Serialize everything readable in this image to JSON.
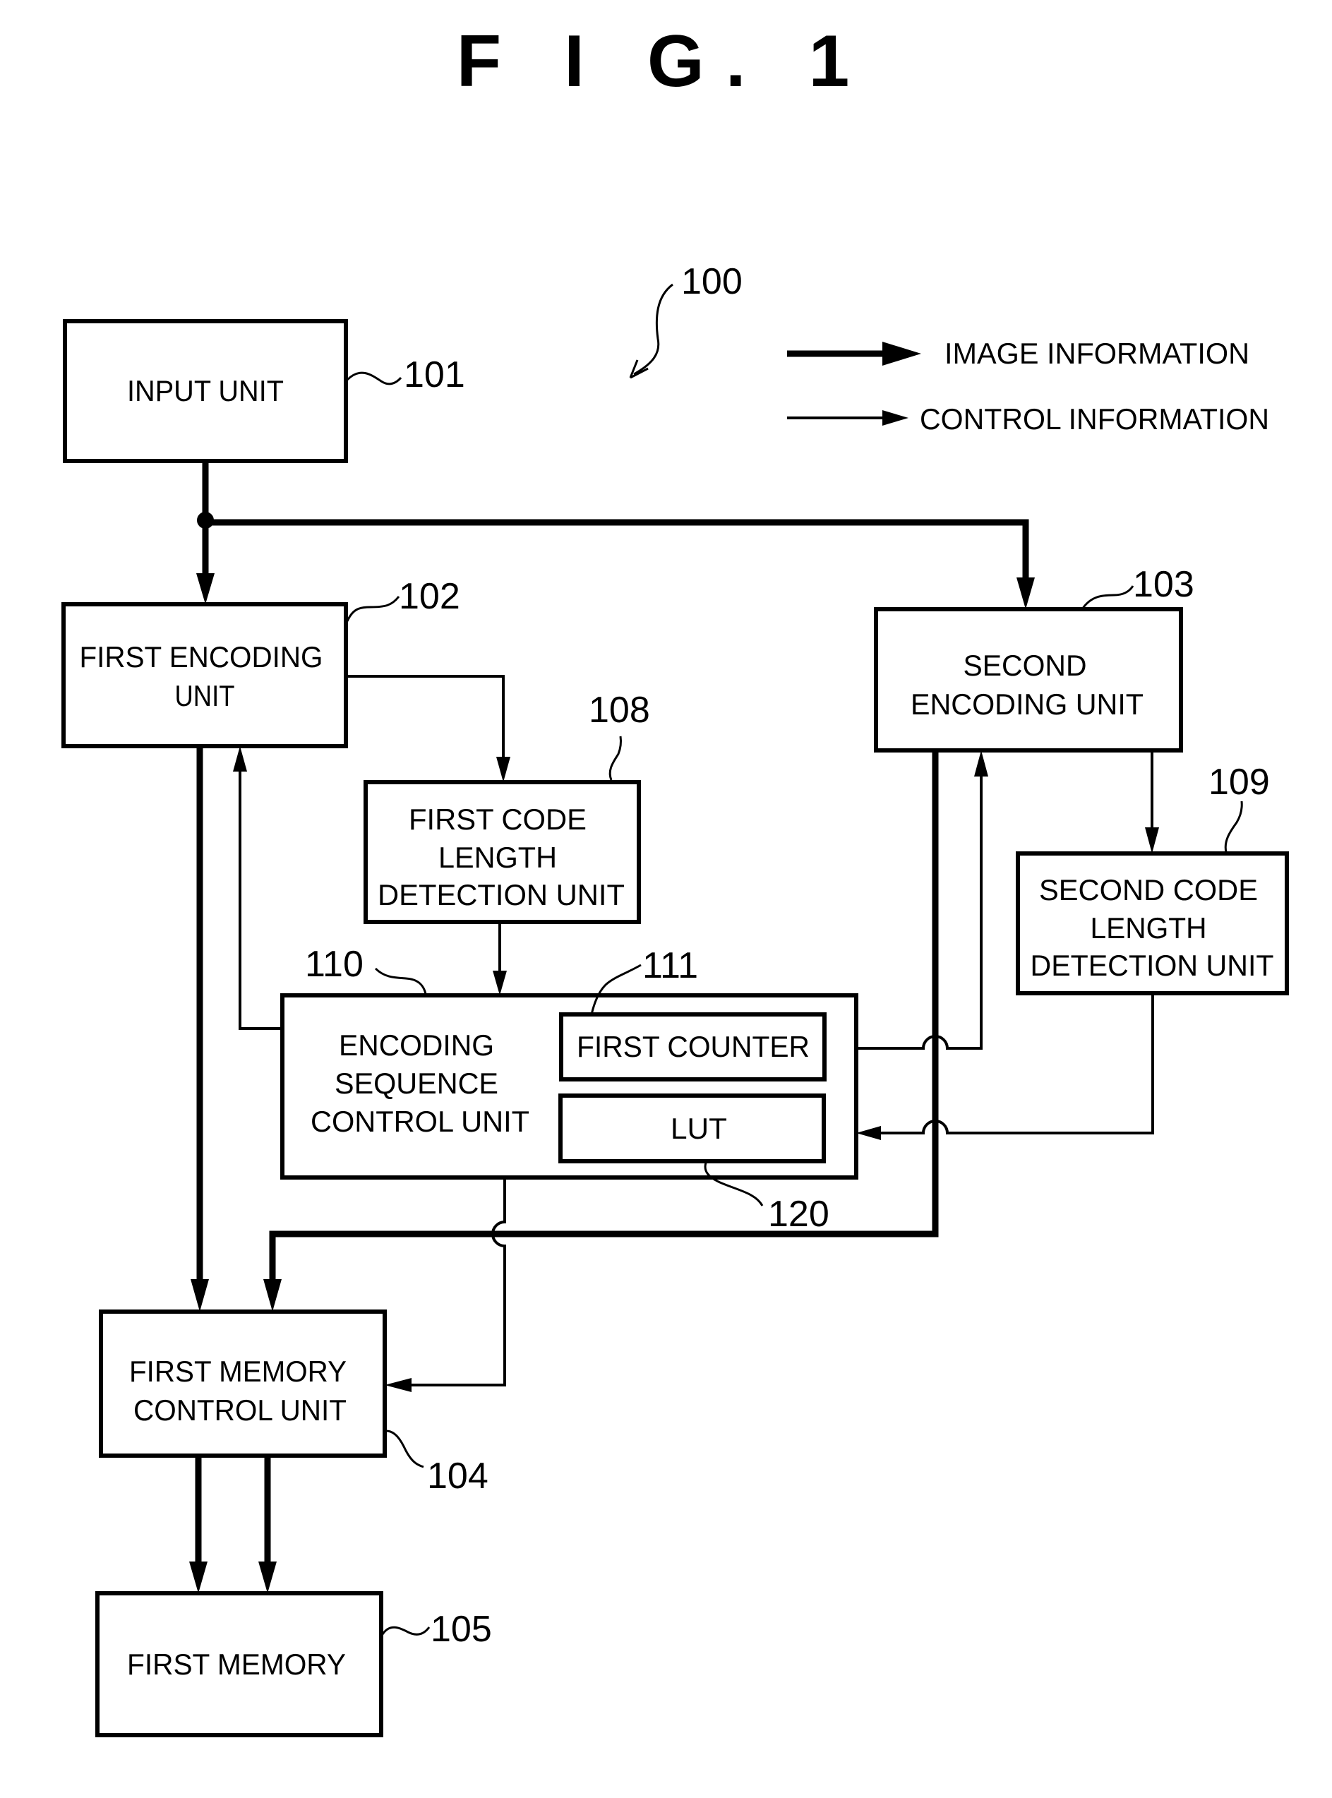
{
  "figure": {
    "title": "F I G.  1",
    "system_ref": "100"
  },
  "legend": {
    "image_information": "IMAGE INFORMATION",
    "control_information": "CONTROL INFORMATION"
  },
  "blocks": {
    "input_unit": {
      "lines": [
        "INPUT UNIT"
      ],
      "ref": "101"
    },
    "first_encoding_unit": {
      "lines": [
        "FIRST ENCODING",
        "UNIT"
      ],
      "ref": "102"
    },
    "second_encoding_unit": {
      "lines": [
        "SECOND",
        "ENCODING UNIT"
      ],
      "ref": "103"
    },
    "first_code_length_detection_unit": {
      "lines": [
        "FIRST CODE",
        "LENGTH",
        "DETECTION UNIT"
      ],
      "ref": "108"
    },
    "second_code_length_detection_unit": {
      "lines": [
        "SECOND CODE",
        "LENGTH",
        "DETECTION UNIT"
      ],
      "ref": "109"
    },
    "encoding_sequence_control_unit": {
      "lines": [
        "ENCODING",
        "SEQUENCE",
        "CONTROL UNIT"
      ],
      "ref": "110"
    },
    "first_counter": {
      "lines": [
        "FIRST COUNTER"
      ],
      "ref": "111"
    },
    "lut": {
      "lines": [
        "LUT"
      ],
      "ref": "120"
    },
    "first_memory_control_unit": {
      "lines": [
        "FIRST MEMORY",
        "CONTROL UNIT"
      ],
      "ref": "104"
    },
    "first_memory": {
      "lines": [
        "FIRST MEMORY"
      ],
      "ref": "105"
    }
  }
}
